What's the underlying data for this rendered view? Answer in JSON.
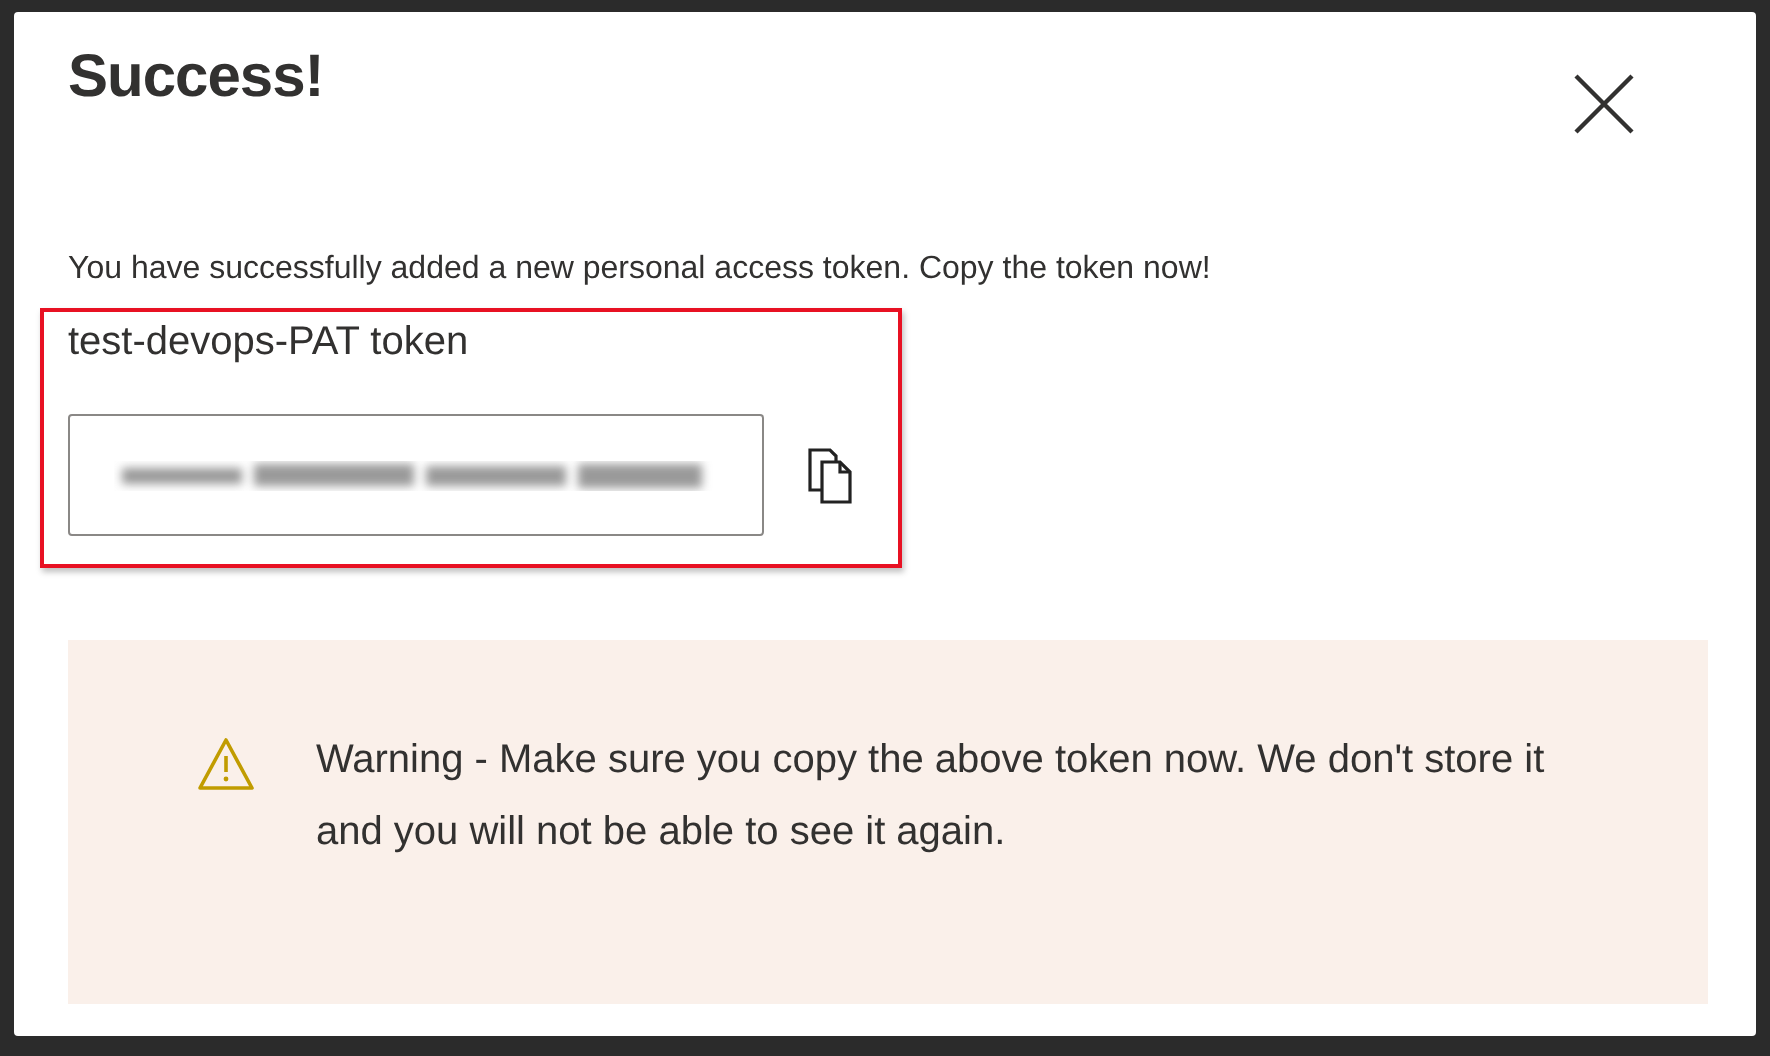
{
  "dialog": {
    "title": "Success!",
    "message": "You have successfully added a new personal access token. Copy the token now!",
    "token_name": "test-devops-PAT token",
    "warning": "Warning - Make sure you copy the above token now. We don't store it and you will not be able to see it again."
  }
}
